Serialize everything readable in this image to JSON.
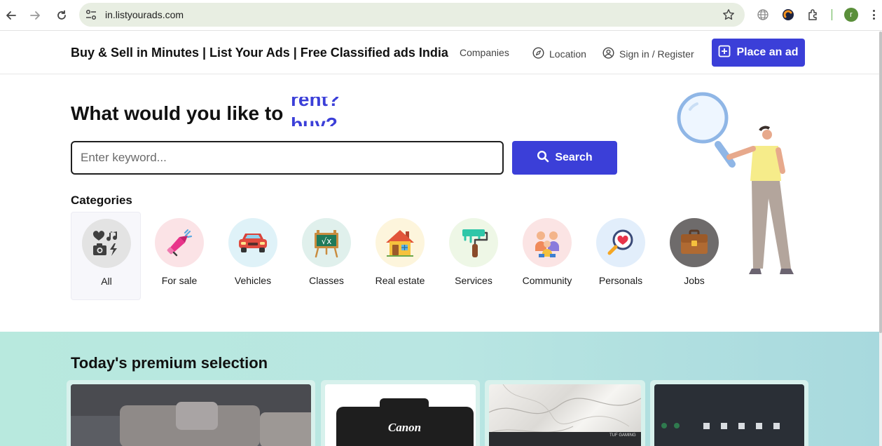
{
  "browser": {
    "url": "in.listyourads.com",
    "profile_initial": "r"
  },
  "header": {
    "site_title": "Buy & Sell in Minutes | List Your Ads | Free Classified ads India",
    "companies": "Companies",
    "location": "Location",
    "sign_in": "Sign in / Register",
    "place_ad": "Place an ad"
  },
  "hero": {
    "heading": "What would you like to",
    "rotating_words": [
      "rent?",
      "buy?"
    ],
    "search_placeholder": "Enter keyword...",
    "search_button": "Search"
  },
  "categories": {
    "title": "Categories",
    "items": [
      {
        "label": "All",
        "icon": "heart-music-camera-icon",
        "bg": "#e3e3e3"
      },
      {
        "label": "For sale",
        "icon": "megaphone-icon",
        "bg": "#fbe3e6"
      },
      {
        "label": "Vehicles",
        "icon": "car-icon",
        "bg": "#dff2f8"
      },
      {
        "label": "Classes",
        "icon": "chalkboard-icon",
        "bg": "#e0f0ec"
      },
      {
        "label": "Real estate",
        "icon": "house-icon",
        "bg": "#fdf5dc"
      },
      {
        "label": "Services",
        "icon": "paint-roller-icon",
        "bg": "#eef7e6"
      },
      {
        "label": "Community",
        "icon": "people-icon",
        "bg": "#fbe4e4"
      },
      {
        "label": "Personals",
        "icon": "magnifier-heart-icon",
        "bg": "#e2eefb"
      },
      {
        "label": "Jobs",
        "icon": "briefcase-icon",
        "bg": "#6e6b6b"
      }
    ]
  },
  "premium": {
    "title": "Today's premium selection",
    "cards": [
      {
        "image": "sofa-photo"
      },
      {
        "image": "canon-camera-photo",
        "brand": "Canon"
      },
      {
        "image": "marble-laptop-photo",
        "caption": "TUF GAMING"
      },
      {
        "image": "dark-device-photo"
      }
    ]
  },
  "colors": {
    "primary": "#3b3fd8",
    "premium_bg": "#b8e9de"
  }
}
